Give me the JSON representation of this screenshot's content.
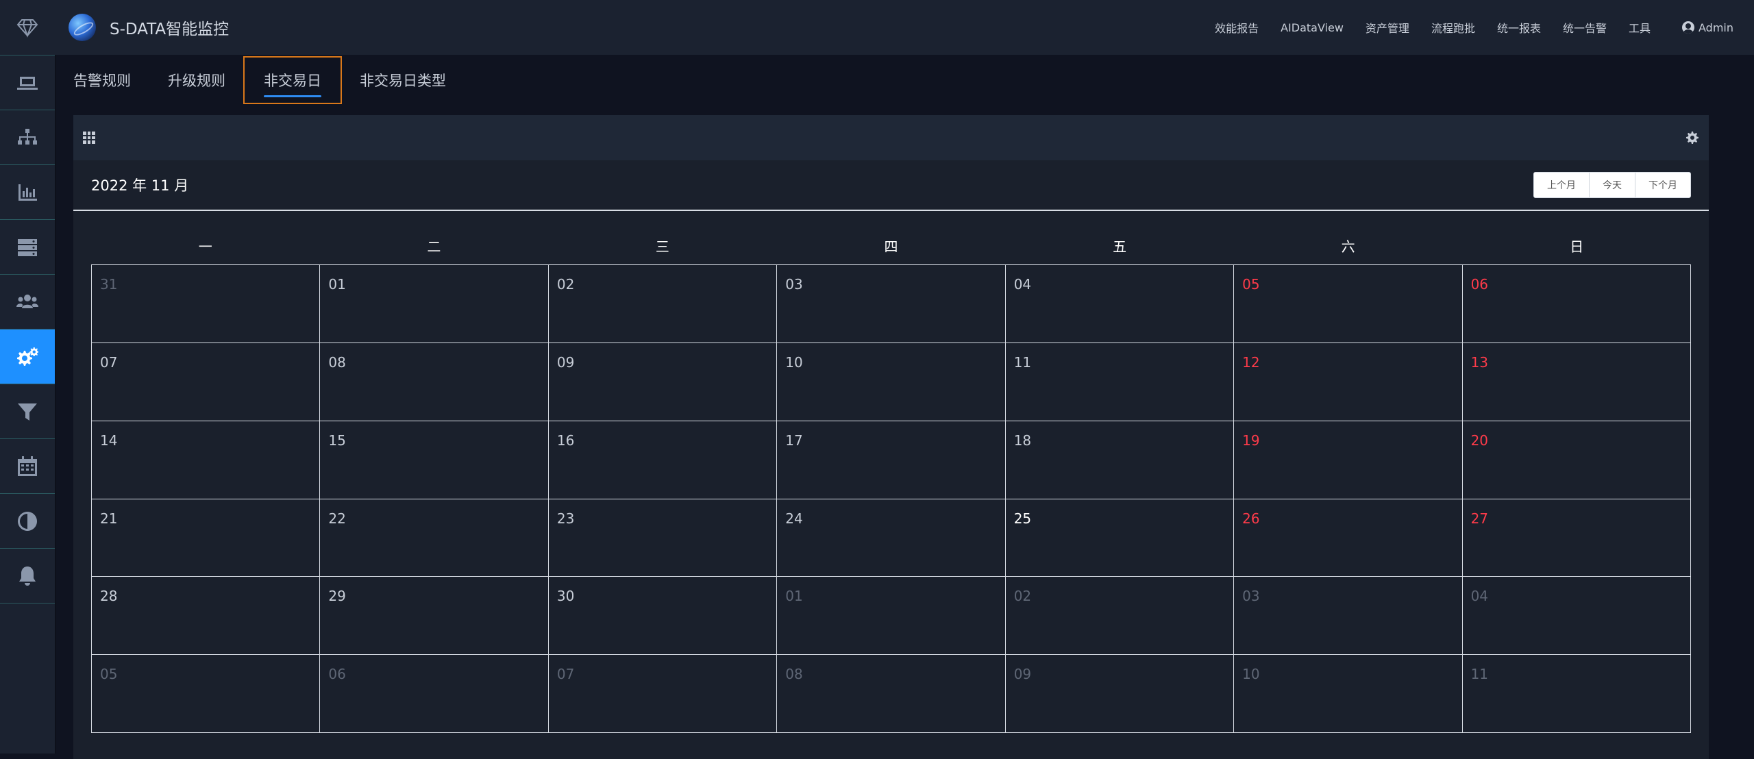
{
  "app": {
    "title": "S-DATA智能监控"
  },
  "topnav": {
    "items": [
      "效能报告",
      "AIDataView",
      "资产管理",
      "流程跑批",
      "统一报表",
      "统一告警",
      "工具"
    ],
    "admin": "Admin"
  },
  "sidebar": {
    "icons": [
      "diamond-logo-icon",
      "monitor-icon",
      "sitemap-icon",
      "bar-chart-icon",
      "server-icon",
      "users-icon",
      "gears-icon",
      "filter-icon",
      "calendar-icon",
      "contrast-icon",
      "bell-icon"
    ],
    "active_index": 5
  },
  "tabs": [
    {
      "label": "告警规则",
      "active": false
    },
    {
      "label": "升级规则",
      "active": false
    },
    {
      "label": "非交易日",
      "active": true
    },
    {
      "label": "非交易日类型",
      "active": false
    }
  ],
  "calendar": {
    "title": "2022 年 11 月",
    "buttons": {
      "prev": "上个月",
      "today": "今天",
      "next": "下个月"
    },
    "weekdays": [
      "一",
      "二",
      "三",
      "四",
      "五",
      "六",
      "日"
    ],
    "weeks": [
      [
        {
          "d": "31",
          "t": "other"
        },
        {
          "d": "01",
          "t": ""
        },
        {
          "d": "02",
          "t": ""
        },
        {
          "d": "03",
          "t": ""
        },
        {
          "d": "04",
          "t": ""
        },
        {
          "d": "05",
          "t": "weekend"
        },
        {
          "d": "06",
          "t": "weekend"
        }
      ],
      [
        {
          "d": "07",
          "t": ""
        },
        {
          "d": "08",
          "t": ""
        },
        {
          "d": "09",
          "t": ""
        },
        {
          "d": "10",
          "t": ""
        },
        {
          "d": "11",
          "t": ""
        },
        {
          "d": "12",
          "t": "weekend"
        },
        {
          "d": "13",
          "t": "weekend"
        }
      ],
      [
        {
          "d": "14",
          "t": ""
        },
        {
          "d": "15",
          "t": ""
        },
        {
          "d": "16",
          "t": ""
        },
        {
          "d": "17",
          "t": ""
        },
        {
          "d": "18",
          "t": ""
        },
        {
          "d": "19",
          "t": "weekend"
        },
        {
          "d": "20",
          "t": "weekend"
        }
      ],
      [
        {
          "d": "21",
          "t": ""
        },
        {
          "d": "22",
          "t": ""
        },
        {
          "d": "23",
          "t": ""
        },
        {
          "d": "24",
          "t": ""
        },
        {
          "d": "25",
          "t": "today"
        },
        {
          "d": "26",
          "t": "weekend"
        },
        {
          "d": "27",
          "t": "weekend"
        }
      ],
      [
        {
          "d": "28",
          "t": ""
        },
        {
          "d": "29",
          "t": ""
        },
        {
          "d": "30",
          "t": ""
        },
        {
          "d": "01",
          "t": "other"
        },
        {
          "d": "02",
          "t": "other"
        },
        {
          "d": "03",
          "t": "other"
        },
        {
          "d": "04",
          "t": "other"
        }
      ],
      [
        {
          "d": "05",
          "t": "other"
        },
        {
          "d": "06",
          "t": "other"
        },
        {
          "d": "07",
          "t": "other"
        },
        {
          "d": "08",
          "t": "other"
        },
        {
          "d": "09",
          "t": "other"
        },
        {
          "d": "10",
          "t": "other"
        },
        {
          "d": "11",
          "t": "other"
        }
      ]
    ]
  },
  "colors": {
    "accent": "#1e90ff",
    "weekend": "#ff3b4a",
    "active_tab_border": "#d9781a"
  }
}
